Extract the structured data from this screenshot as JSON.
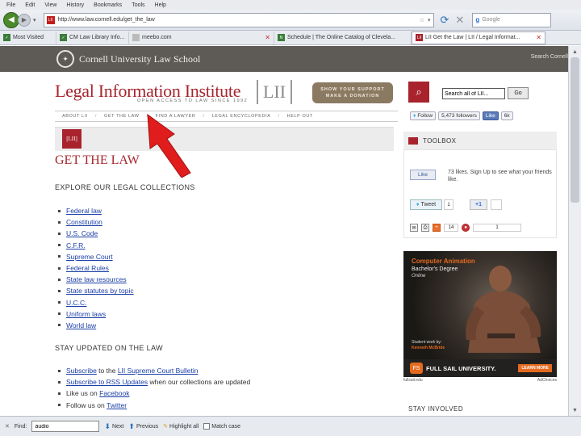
{
  "menubar": [
    "File",
    "Edit",
    "View",
    "History",
    "Bookmarks",
    "Tools",
    "Help"
  ],
  "browser": {
    "url": "http://www.law.cornell.edu/get_the_law",
    "search_placeholder": "Google"
  },
  "tabs": [
    {
      "label": "Most Visited"
    },
    {
      "label": "CM Law Library Info..."
    },
    {
      "label": "meebo.com"
    },
    {
      "label": "Schedule | The Online Catalog of Clevela..."
    },
    {
      "label": "LII Get the Law | LII / Legal Informat..."
    }
  ],
  "cornell": {
    "name": "Cornell University Law School",
    "search_link": "Search Cornell"
  },
  "lii": {
    "title": "Legal Information Institute",
    "subtitle": "OPEN ACCESS TO LAW SINCE 1992",
    "logo": "LII",
    "donate_line1": "SHOW YOUR SUPPORT",
    "donate_line2": "MAKE A DONATION",
    "search_value": "Search all of LII...",
    "go_label": "Go"
  },
  "nav": [
    "ABOUT LII",
    "GET THE LAW",
    "FIND A LAWYER",
    "LEGAL ENCYCLOPEDIA",
    "HELP OUT"
  ],
  "social": {
    "follow_label": "Follow",
    "followers": "5,473 followers",
    "like_label": "Like",
    "like_count": "6k"
  },
  "page": {
    "badge": "[LII]",
    "title": "GET THE LAW",
    "explore_heading": "EXPLORE OUR LEGAL COLLECTIONS",
    "collections": [
      "Federal law",
      "Constitution",
      "U.S. Code",
      "C.F.R.",
      "Supreme Court",
      "Federal Rules",
      "State law resources",
      "State statutes by topic",
      "U.C.C.",
      "Uniform laws",
      "World law"
    ],
    "stay_heading": "STAY UPDATED ON THE LAW",
    "updates": [
      {
        "link": "Subscribe",
        "text": " to the ",
        "link2": "LII Supreme Court Bulletin"
      },
      {
        "link": "Subscribe to RSS Updates",
        "text": " when our collections are updated",
        "link2": ""
      },
      {
        "link": "",
        "text": "Like us on ",
        "link2": "Facebook"
      },
      {
        "link": "",
        "text": "Follow us on ",
        "link2": "Twitter"
      }
    ]
  },
  "sidebar": {
    "toolbox": "TOOLBOX",
    "like_btn": "Like",
    "likes_text": "73 likes. Sign Up to see what your friends like.",
    "tweet_label": "Tweet",
    "tweet_count": "1",
    "plusone_label": "+1",
    "share_count": "14",
    "reddit_count": "1",
    "stay_heading": "STAY INVOLVED"
  },
  "ad": {
    "title": "Computer Animation",
    "degree": "Bachelor's Degree",
    "online": "Online",
    "credit_label": "Student work by:",
    "credit_name": "Kenneth McBride",
    "school": "FULL SAIL UNIVERSITY.",
    "cta": "LEARN MORE",
    "foot_left": "fullsail.edu",
    "foot_right": "AdChoices"
  },
  "findbar": {
    "label": "Find:",
    "value": "audio",
    "next": "Next",
    "previous": "Previous",
    "highlight": "Highlight all",
    "matchcase": "Match case"
  },
  "colors": {
    "lii_red": "#a7262f",
    "cornell_gray": "#5e5b57",
    "arrow_red": "#e01c1c",
    "link_blue": "#1a3ea6"
  }
}
